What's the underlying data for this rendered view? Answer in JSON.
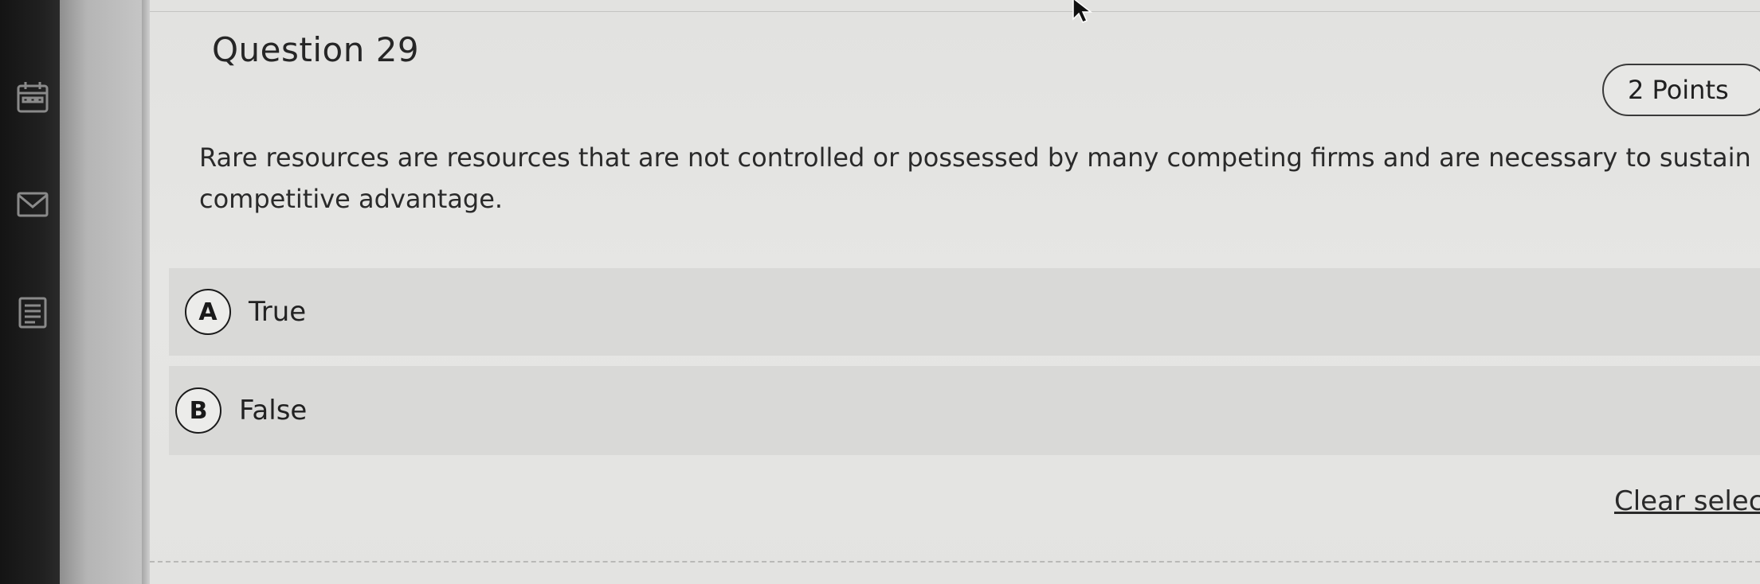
{
  "question": {
    "title": "Question 29",
    "points": "2 Points",
    "text": "Rare resources are resources that are not controlled or possessed by many competing firms and are necessary to sustain a competitive advantage."
  },
  "options": [
    {
      "letter": "A",
      "label": "True"
    },
    {
      "letter": "B",
      "label": "False"
    }
  ],
  "actions": {
    "clear_selection": "Clear selecti"
  },
  "rail_icons": [
    "calendar-icon",
    "mail-icon",
    "notes-icon"
  ],
  "colors": {
    "page_background": "#e4e4e2",
    "option_background": "#d9d9d7",
    "text": "#2a2a2a"
  }
}
